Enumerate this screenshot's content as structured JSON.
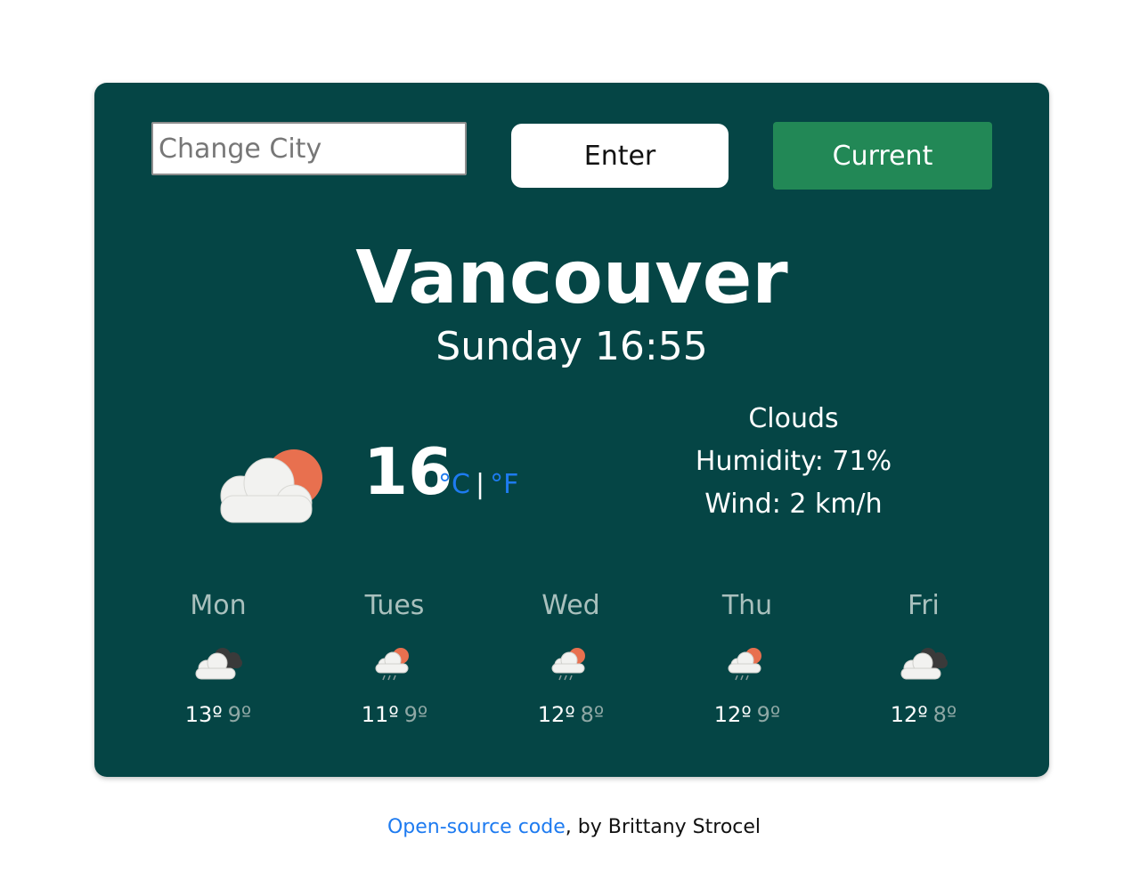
{
  "search": {
    "placeholder": "Change City",
    "value": ""
  },
  "buttons": {
    "enter_label": "Enter",
    "current_label": "Current"
  },
  "current": {
    "city": "Vancouver",
    "date_time": "Sunday 16:55",
    "icon": "sun-behind-cloud-icon",
    "temperature": "16",
    "unit_celsius": "°C",
    "unit_separator": "|",
    "unit_fahrenheit": "°F",
    "description": "Clouds",
    "humidity": "Humidity: 71%",
    "wind": "Wind: 2 km/h"
  },
  "forecast": [
    {
      "day": "Mon",
      "icon": "dark-clouds-icon",
      "high": "13º",
      "low": "9º"
    },
    {
      "day": "Tues",
      "icon": "sun-cloud-rain-icon",
      "high": "11º",
      "low": "9º"
    },
    {
      "day": "Wed",
      "icon": "sun-cloud-rain-icon",
      "high": "12º",
      "low": "8º"
    },
    {
      "day": "Thu",
      "icon": "sun-cloud-rain-icon",
      "high": "12º",
      "low": "9º"
    },
    {
      "day": "Fri",
      "icon": "dark-clouds-icon",
      "high": "12º",
      "low": "8º"
    }
  ],
  "footer": {
    "link_text": "Open-source code",
    "suffix": ", by Brittany Strocel"
  },
  "colors": {
    "card_bg": "#054545",
    "current_button": "#228856",
    "link": "#1e7bf0",
    "sun": "#e8704f",
    "cloud": "#f2f2f0",
    "dark_cloud": "#3a3a3a"
  }
}
